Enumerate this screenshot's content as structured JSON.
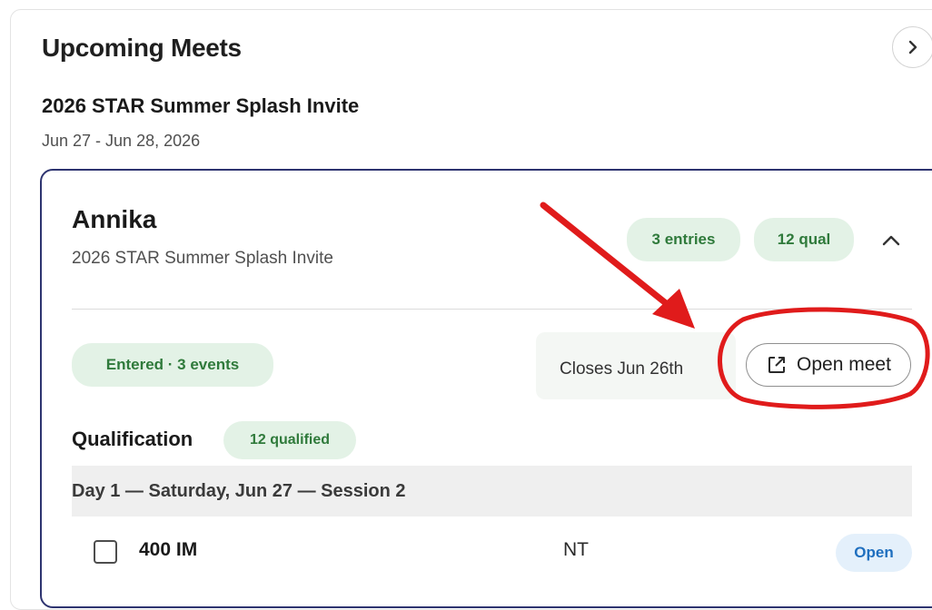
{
  "header": {
    "title": "Upcoming Meets",
    "next_icon": "chevron-right-icon"
  },
  "meet": {
    "name": "2026 STAR Summer Splash Invite",
    "dates": "Jun 27 - Jun 28, 2026"
  },
  "entry": {
    "swimmer_name": "Annika",
    "meet_name": "2026 STAR Summer Splash Invite",
    "entries_badge": "3 entries",
    "qual_badge": "12 qual",
    "collapse_icon": "chevron-up-icon",
    "status": "Entered · 3 events",
    "closes": "Closes Jun 26th",
    "open_meet_label": "Open meet",
    "open_meet_icon": "external-link-icon"
  },
  "qualification": {
    "label": "Qualification",
    "count_badge": "12 qualified"
  },
  "sessions": [
    {
      "header": "Day 1 — Saturday, Jun 27 — Session 2",
      "events": [
        {
          "name": "400 IM",
          "time": "NT",
          "status": "Open"
        }
      ]
    }
  ],
  "annotations": {
    "arrow_color": "#e01b1b",
    "circle_color": "#e01b1b"
  },
  "colors": {
    "accent_green_bg": "#e3f2e6",
    "accent_green_text": "#2f7a3b",
    "card_border": "#2e3470",
    "open_blue_bg": "#e4f0fb",
    "open_blue_text": "#1f6fbf"
  }
}
